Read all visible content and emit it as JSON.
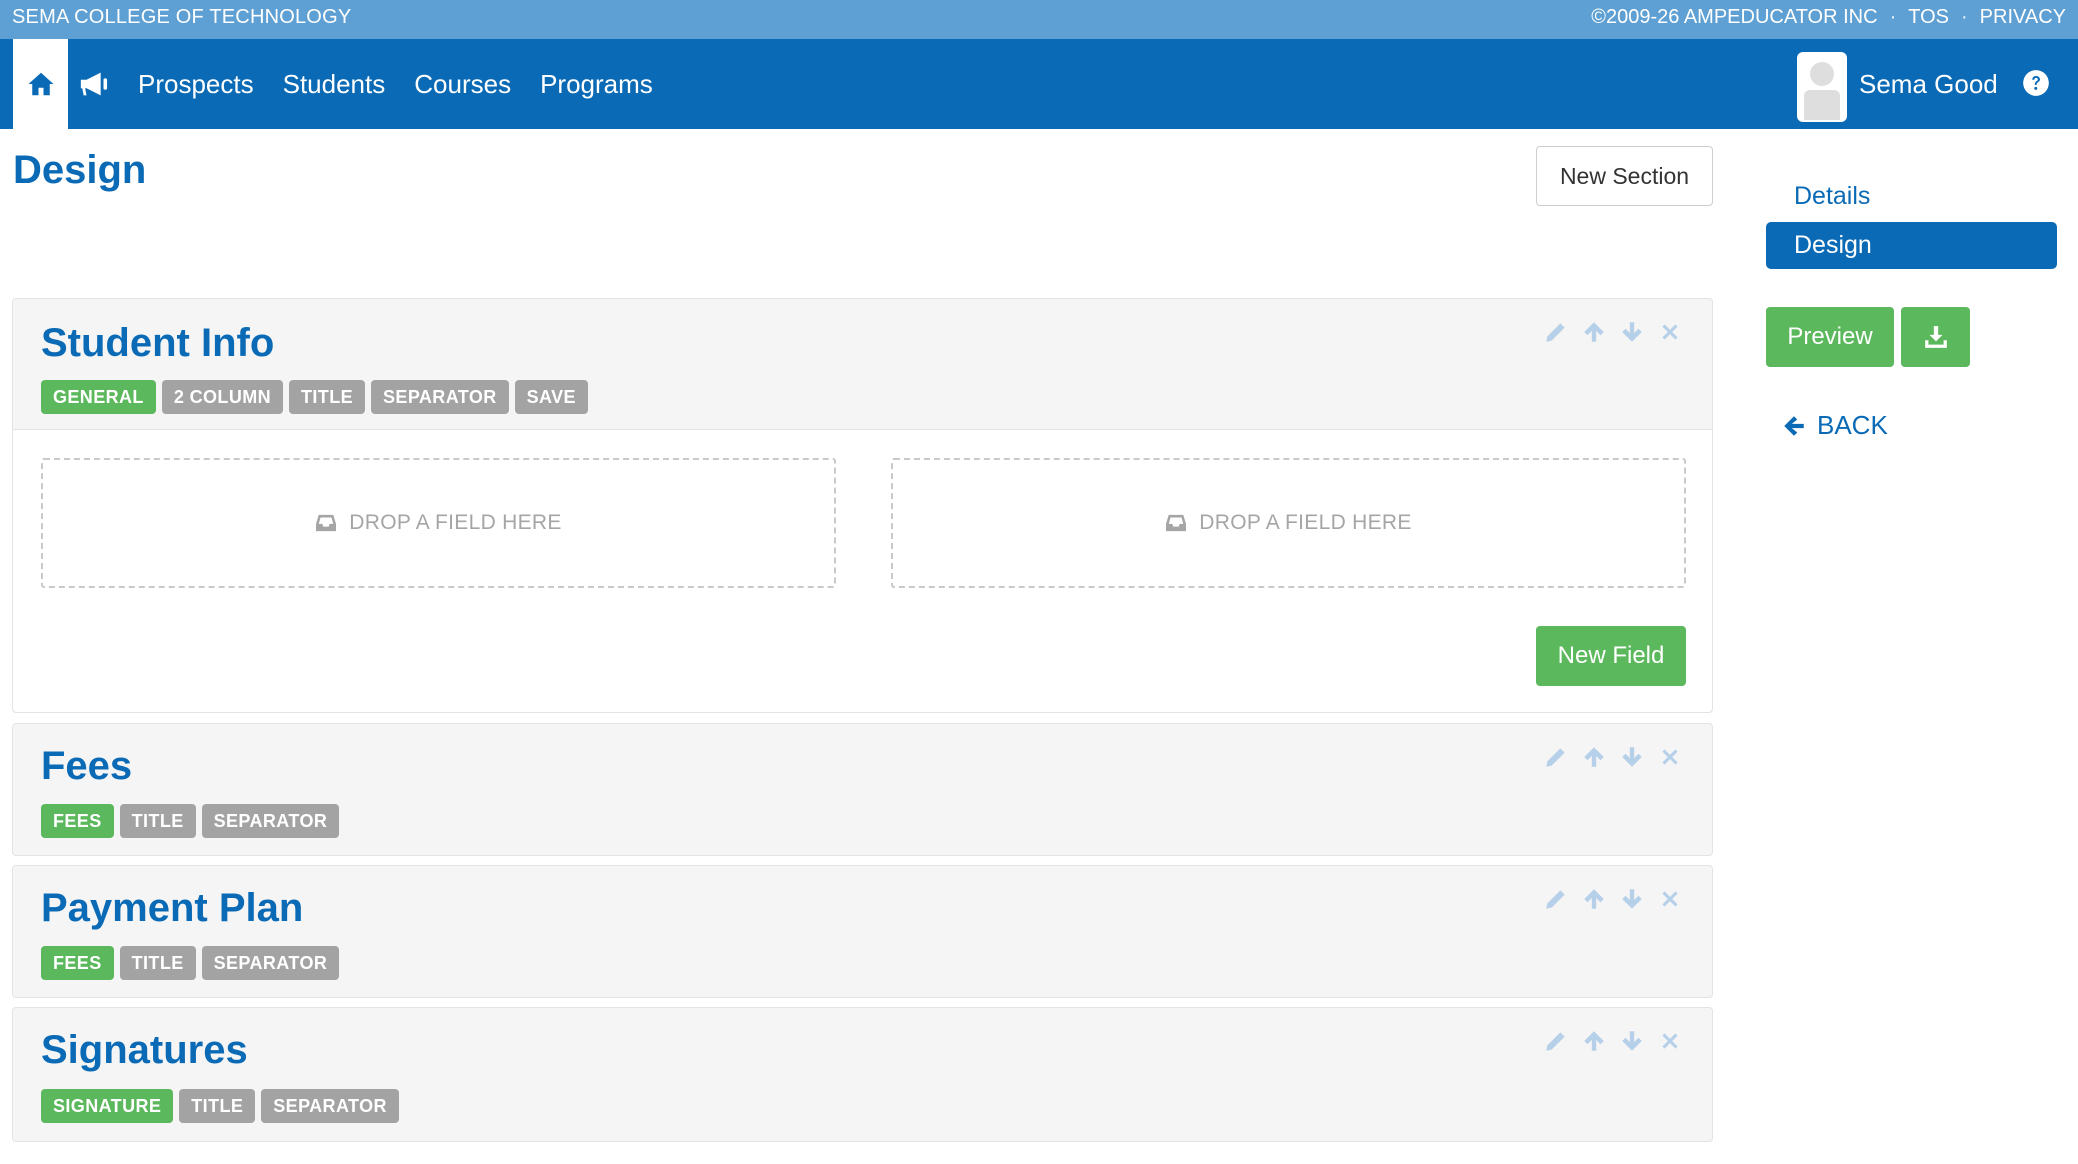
{
  "topbar": {
    "org": "SEMA COLLEGE OF TECHNOLOGY",
    "copyright": "©2009-26 AMPEDUCATOR INC",
    "tos": "TOS",
    "privacy": "PRIVACY",
    "separator": "·"
  },
  "nav": {
    "items": [
      {
        "label": "Prospects"
      },
      {
        "label": "Students"
      },
      {
        "label": "Courses"
      },
      {
        "label": "Programs"
      }
    ],
    "user": "Sema Good"
  },
  "page": {
    "title": "Design",
    "new_section": "New Section"
  },
  "sections": [
    {
      "title": "Student Info",
      "tags": [
        "GENERAL",
        "2 COLUMN",
        "TITLE",
        "SEPARATOR",
        "SAVE"
      ],
      "drop_label": "DROP A FIELD HERE",
      "new_field": "New Field"
    },
    {
      "title": "Fees",
      "tags": [
        "FEES",
        "TITLE",
        "SEPARATOR"
      ]
    },
    {
      "title": "Payment Plan",
      "tags": [
        "FEES",
        "TITLE",
        "SEPARATOR"
      ]
    },
    {
      "title": "Signatures",
      "tags": [
        "SIGNATURE",
        "TITLE",
        "SEPARATOR"
      ]
    }
  ],
  "sidebar": {
    "details": "Details",
    "design": "Design",
    "preview": "Preview",
    "back": "BACK"
  },
  "icons": {
    "home": "home-icon",
    "announce": "megaphone-icon",
    "help": "help-icon",
    "edit": "pencil-icon",
    "up": "arrow-up-icon",
    "down": "arrow-down-icon",
    "remove": "close-icon",
    "inbox": "inbox-icon",
    "download": "download-icon",
    "back": "arrow-left-icon"
  },
  "colors": {
    "primary": "#0a6ab5",
    "topbar": "#5ea0d3",
    "success": "#5cb85c",
    "muted_tag": "#a3a3a3",
    "tool_icon": "#b6d0ea"
  }
}
